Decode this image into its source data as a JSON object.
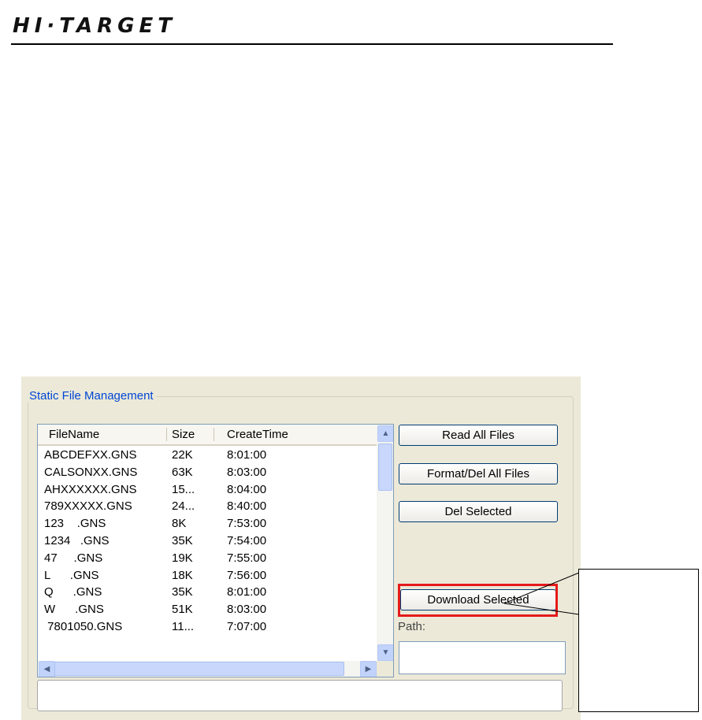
{
  "brand": {
    "logo_text": "HI·TARGET"
  },
  "group": {
    "title": "Static File Management"
  },
  "table": {
    "columns": [
      "FileName",
      "Size",
      "CreateTime"
    ],
    "rows": [
      {
        "name": "ABCDEFXX.GNS",
        "size": "22K",
        "time": "8:01:00"
      },
      {
        "name": "CALSONXX.GNS",
        "size": "63K",
        "time": "8:03:00"
      },
      {
        "name": "AHXXXXXX.GNS",
        "size": "15...",
        "time": "8:04:00"
      },
      {
        "name": "789XXXXX.GNS",
        "size": "24...",
        "time": "8:40:00"
      },
      {
        "name": "123    .GNS",
        "size": "8K",
        "time": "7:53:00"
      },
      {
        "name": "1234   .GNS",
        "size": "35K",
        "time": "7:54:00"
      },
      {
        "name": "47     .GNS",
        "size": "19K",
        "time": "7:55:00"
      },
      {
        "name": "L      .GNS",
        "size": "18K",
        "time": "7:56:00"
      },
      {
        "name": "Q      .GNS",
        "size": "35K",
        "time": "8:01:00"
      },
      {
        "name": "W      .GNS",
        "size": "51K",
        "time": "8:03:00"
      },
      {
        "name": " 7801050.GNS",
        "size": "11...",
        "time": "7:07:00"
      }
    ]
  },
  "buttons": {
    "read_all": "Read All Files",
    "format_del": "Format/Del All Files",
    "del_selected": "Del Selected",
    "download_selected": "Download Selected"
  },
  "path": {
    "label": "Path:",
    "value": ""
  },
  "status": {
    "text": ""
  },
  "icons": {
    "scroll_up": "scroll-up-arrow-icon",
    "scroll_down": "scroll-down-arrow-icon",
    "scroll_left": "scroll-left-arrow-icon",
    "scroll_right": "scroll-right-arrow-icon"
  },
  "colors": {
    "highlight": "#e51a1a",
    "group_title": "#0046d5",
    "panel_bg": "#ece9d8"
  }
}
